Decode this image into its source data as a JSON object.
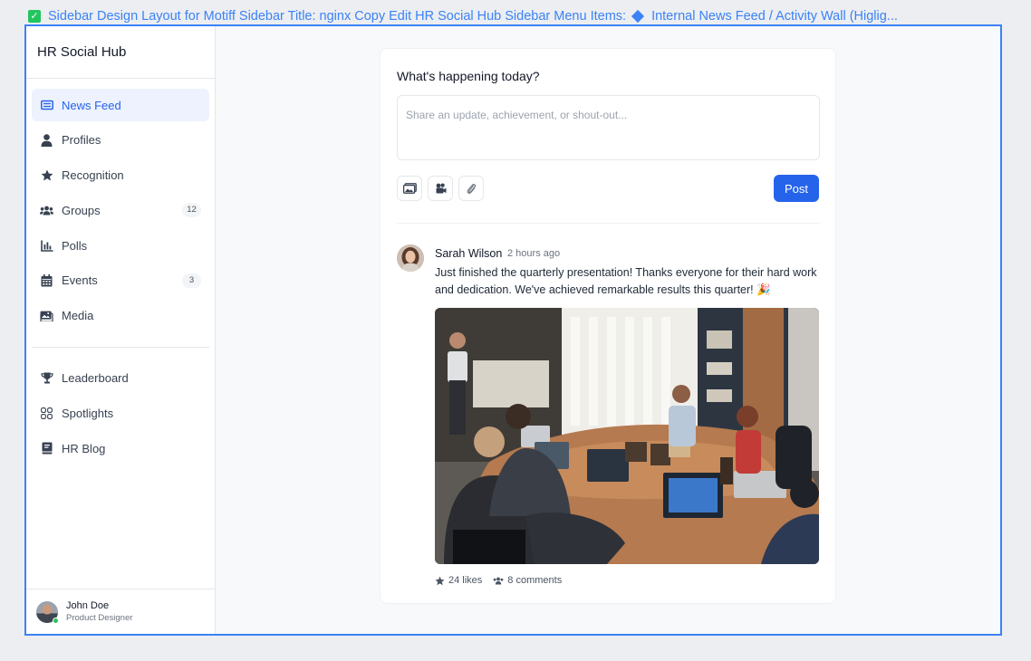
{
  "titlebar": {
    "text": "Sidebar Design Layout for Motiff Sidebar Title:  nginx Copy Edit HR Social Hub Sidebar Menu Items:",
    "text2": "Internal News Feed / Activity Wall (Higlig..."
  },
  "sidebar": {
    "title": "HR Social Hub",
    "items": [
      {
        "label": "News Feed",
        "icon": "newspaper-icon",
        "active": true
      },
      {
        "label": "Profiles",
        "icon": "user-icon"
      },
      {
        "label": "Recognition",
        "icon": "star-icon"
      },
      {
        "label": "Groups",
        "icon": "users-icon",
        "badge": "12"
      },
      {
        "label": "Polls",
        "icon": "bar-chart-icon"
      },
      {
        "label": "Events",
        "icon": "calendar-icon",
        "badge": "3"
      },
      {
        "label": "Media",
        "icon": "photos-icon"
      }
    ],
    "secondary_items": [
      {
        "label": "Leaderboard",
        "icon": "trophy-icon"
      },
      {
        "label": "Spotlights",
        "icon": "grid-icon"
      },
      {
        "label": "HR Blog",
        "icon": "book-icon"
      }
    ],
    "user": {
      "name": "John Doe",
      "role": "Product Designer",
      "status": "online"
    }
  },
  "composer": {
    "title": "What's happening today?",
    "placeholder": "Share an update, achievement, or shout-out...",
    "tools": [
      "photo-icon",
      "video-icon",
      "paperclip-icon"
    ],
    "post_label": "Post"
  },
  "post": {
    "author": "Sarah Wilson",
    "time": "2 hours ago",
    "text": "Just finished the quarterly presentation! Thanks everyone for their hard work and dedication. We've achieved remarkable results this quarter! 🎉",
    "likes": "24 likes",
    "comments": "8 comments"
  },
  "colors": {
    "accent": "#2563eb",
    "frame": "#3b82f6",
    "online": "#22c55e"
  }
}
